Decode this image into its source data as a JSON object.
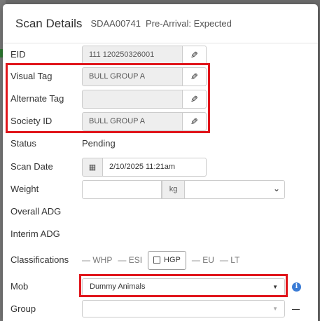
{
  "modal": {
    "title": "Scan Details",
    "scan_id": "SDAA00741",
    "status_header": "Pre-Arrival: Expected"
  },
  "fields": {
    "eid": {
      "label": "EID",
      "value": "111 120250326001"
    },
    "visual_tag": {
      "label": "Visual Tag",
      "value": "BULL GROUP A"
    },
    "alternate_tag": {
      "label": "Alternate Tag",
      "value": ""
    },
    "society_id": {
      "label": "Society ID",
      "value": "BULL GROUP A"
    },
    "status": {
      "label": "Status",
      "value": "Pending"
    },
    "scan_date": {
      "label": "Scan Date",
      "value": "2/10/2025 11:21am"
    },
    "weight": {
      "label": "Weight",
      "value": "",
      "unit": "kg"
    },
    "overall_adg": {
      "label": "Overall ADG"
    },
    "interim_adg": {
      "label": "Interim ADG"
    },
    "classifications": {
      "label": "Classifications",
      "items": [
        "WHP",
        "ESI",
        "HGP",
        "EU",
        "LT"
      ]
    },
    "mob": {
      "label": "Mob",
      "value": "Dummy Animals"
    },
    "group": {
      "label": "Group",
      "value": ""
    }
  },
  "icons": {
    "edit": "pencil-icon",
    "calendar": "calendar-icon",
    "info": "info-icon",
    "dropdown": "chevron-down-icon"
  },
  "colors": {
    "highlight": "#e0151b",
    "info": "#3a7bd5",
    "readonly_bg": "#eeeeee"
  }
}
